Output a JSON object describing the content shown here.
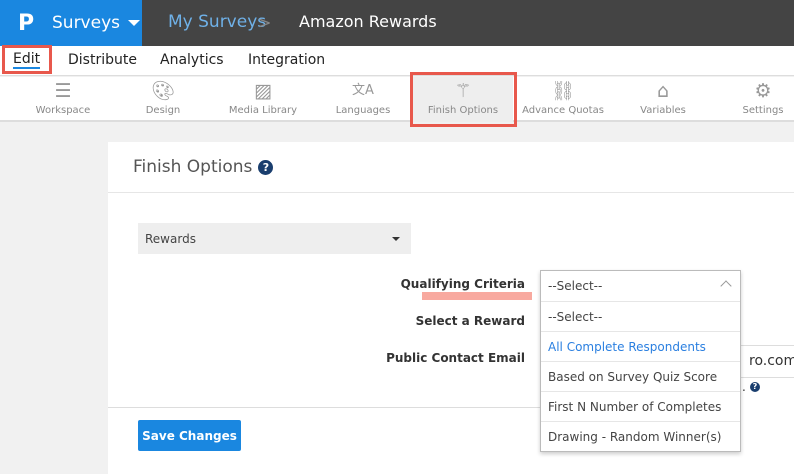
{
  "header": {
    "logo": "P",
    "app": "Surveys",
    "breadcrumb": "My Surveys",
    "separator": ">",
    "current": "Amazon Rewards"
  },
  "tabs": [
    "Edit",
    "Distribute",
    "Analytics",
    "Integration"
  ],
  "tools": [
    {
      "label": "Workspace",
      "icon": "list-pencil-icon"
    },
    {
      "label": "Design",
      "icon": "palette-icon"
    },
    {
      "label": "Media Library",
      "icon": "image-icon"
    },
    {
      "label": "Languages",
      "icon": "translate-icon"
    },
    {
      "label": "Finish Options",
      "icon": "magic-wand-icon",
      "active": true
    },
    {
      "label": "Advance Quotas",
      "icon": "chain-icon"
    },
    {
      "label": "Variables",
      "icon": "tag-icon"
    },
    {
      "label": "Settings",
      "icon": "gear-icon"
    }
  ],
  "panel": {
    "title": "Finish Options",
    "help": "?",
    "reward_select": "Rewards",
    "labels": {
      "criteria": "Qualifying Criteria",
      "reward": "Select a Reward",
      "email": "Public Contact Email"
    },
    "email_partial": "ro.com",
    "note_partial": ".",
    "save": "Save Changes"
  },
  "dropdown": {
    "selected": "--Select--",
    "options": [
      "--Select--",
      "All Complete Respondents",
      "Based on Survey Quiz Score",
      "First N Number of Completes",
      "Drawing - Random Winner(s)"
    ],
    "highlighted": 1
  },
  "colors": {
    "brand": "#1a87e0",
    "highlight_box": "#e8584c"
  }
}
